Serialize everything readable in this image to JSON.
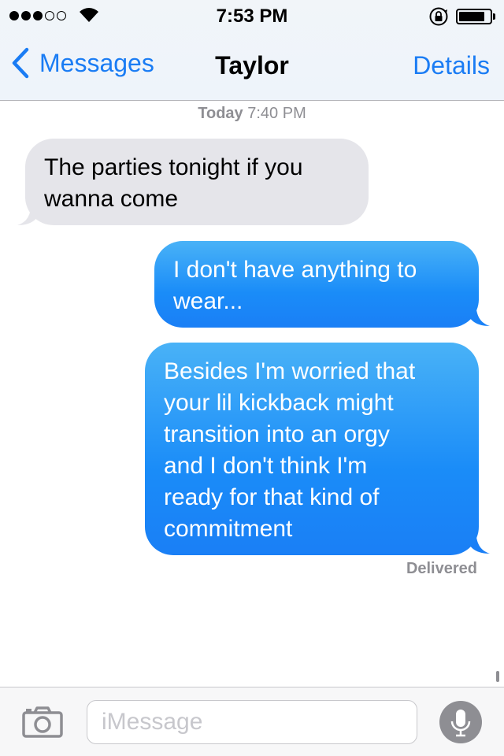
{
  "status_bar": {
    "signal_filled": 3,
    "signal_total": 5,
    "time": "7:53 PM",
    "battery_level": 0.85,
    "icons": [
      "signal-dots-icon",
      "wifi-icon",
      "rotation-lock-icon",
      "battery-icon"
    ]
  },
  "nav": {
    "back_label": "Messages",
    "title": "Taylor",
    "details_label": "Details"
  },
  "conversation": {
    "timestamp_day": "Today",
    "timestamp_time": "7:40 PM",
    "messages": [
      {
        "direction": "incoming",
        "lines": [
          "The parties tonight if you",
          "wanna come"
        ]
      },
      {
        "direction": "outgoing",
        "lines": [
          "I don't have anything to",
          "wear..."
        ]
      },
      {
        "direction": "outgoing",
        "lines": [
          "Besides I'm worried that",
          "your lil kickback might",
          "transition into an orgy",
          "and I don't think I'm",
          "ready for that kind of",
          "commitment"
        ]
      }
    ],
    "delivery_status": "Delivered"
  },
  "input_bar": {
    "placeholder": "iMessage",
    "icons": [
      "camera-icon",
      "microphone-icon"
    ]
  },
  "colors": {
    "accent": "#1a7cf4",
    "incoming_bubble": "#e5e5ea",
    "outgoing_bubble": "#1a8cf8",
    "meta_text": "#8e8e93"
  }
}
